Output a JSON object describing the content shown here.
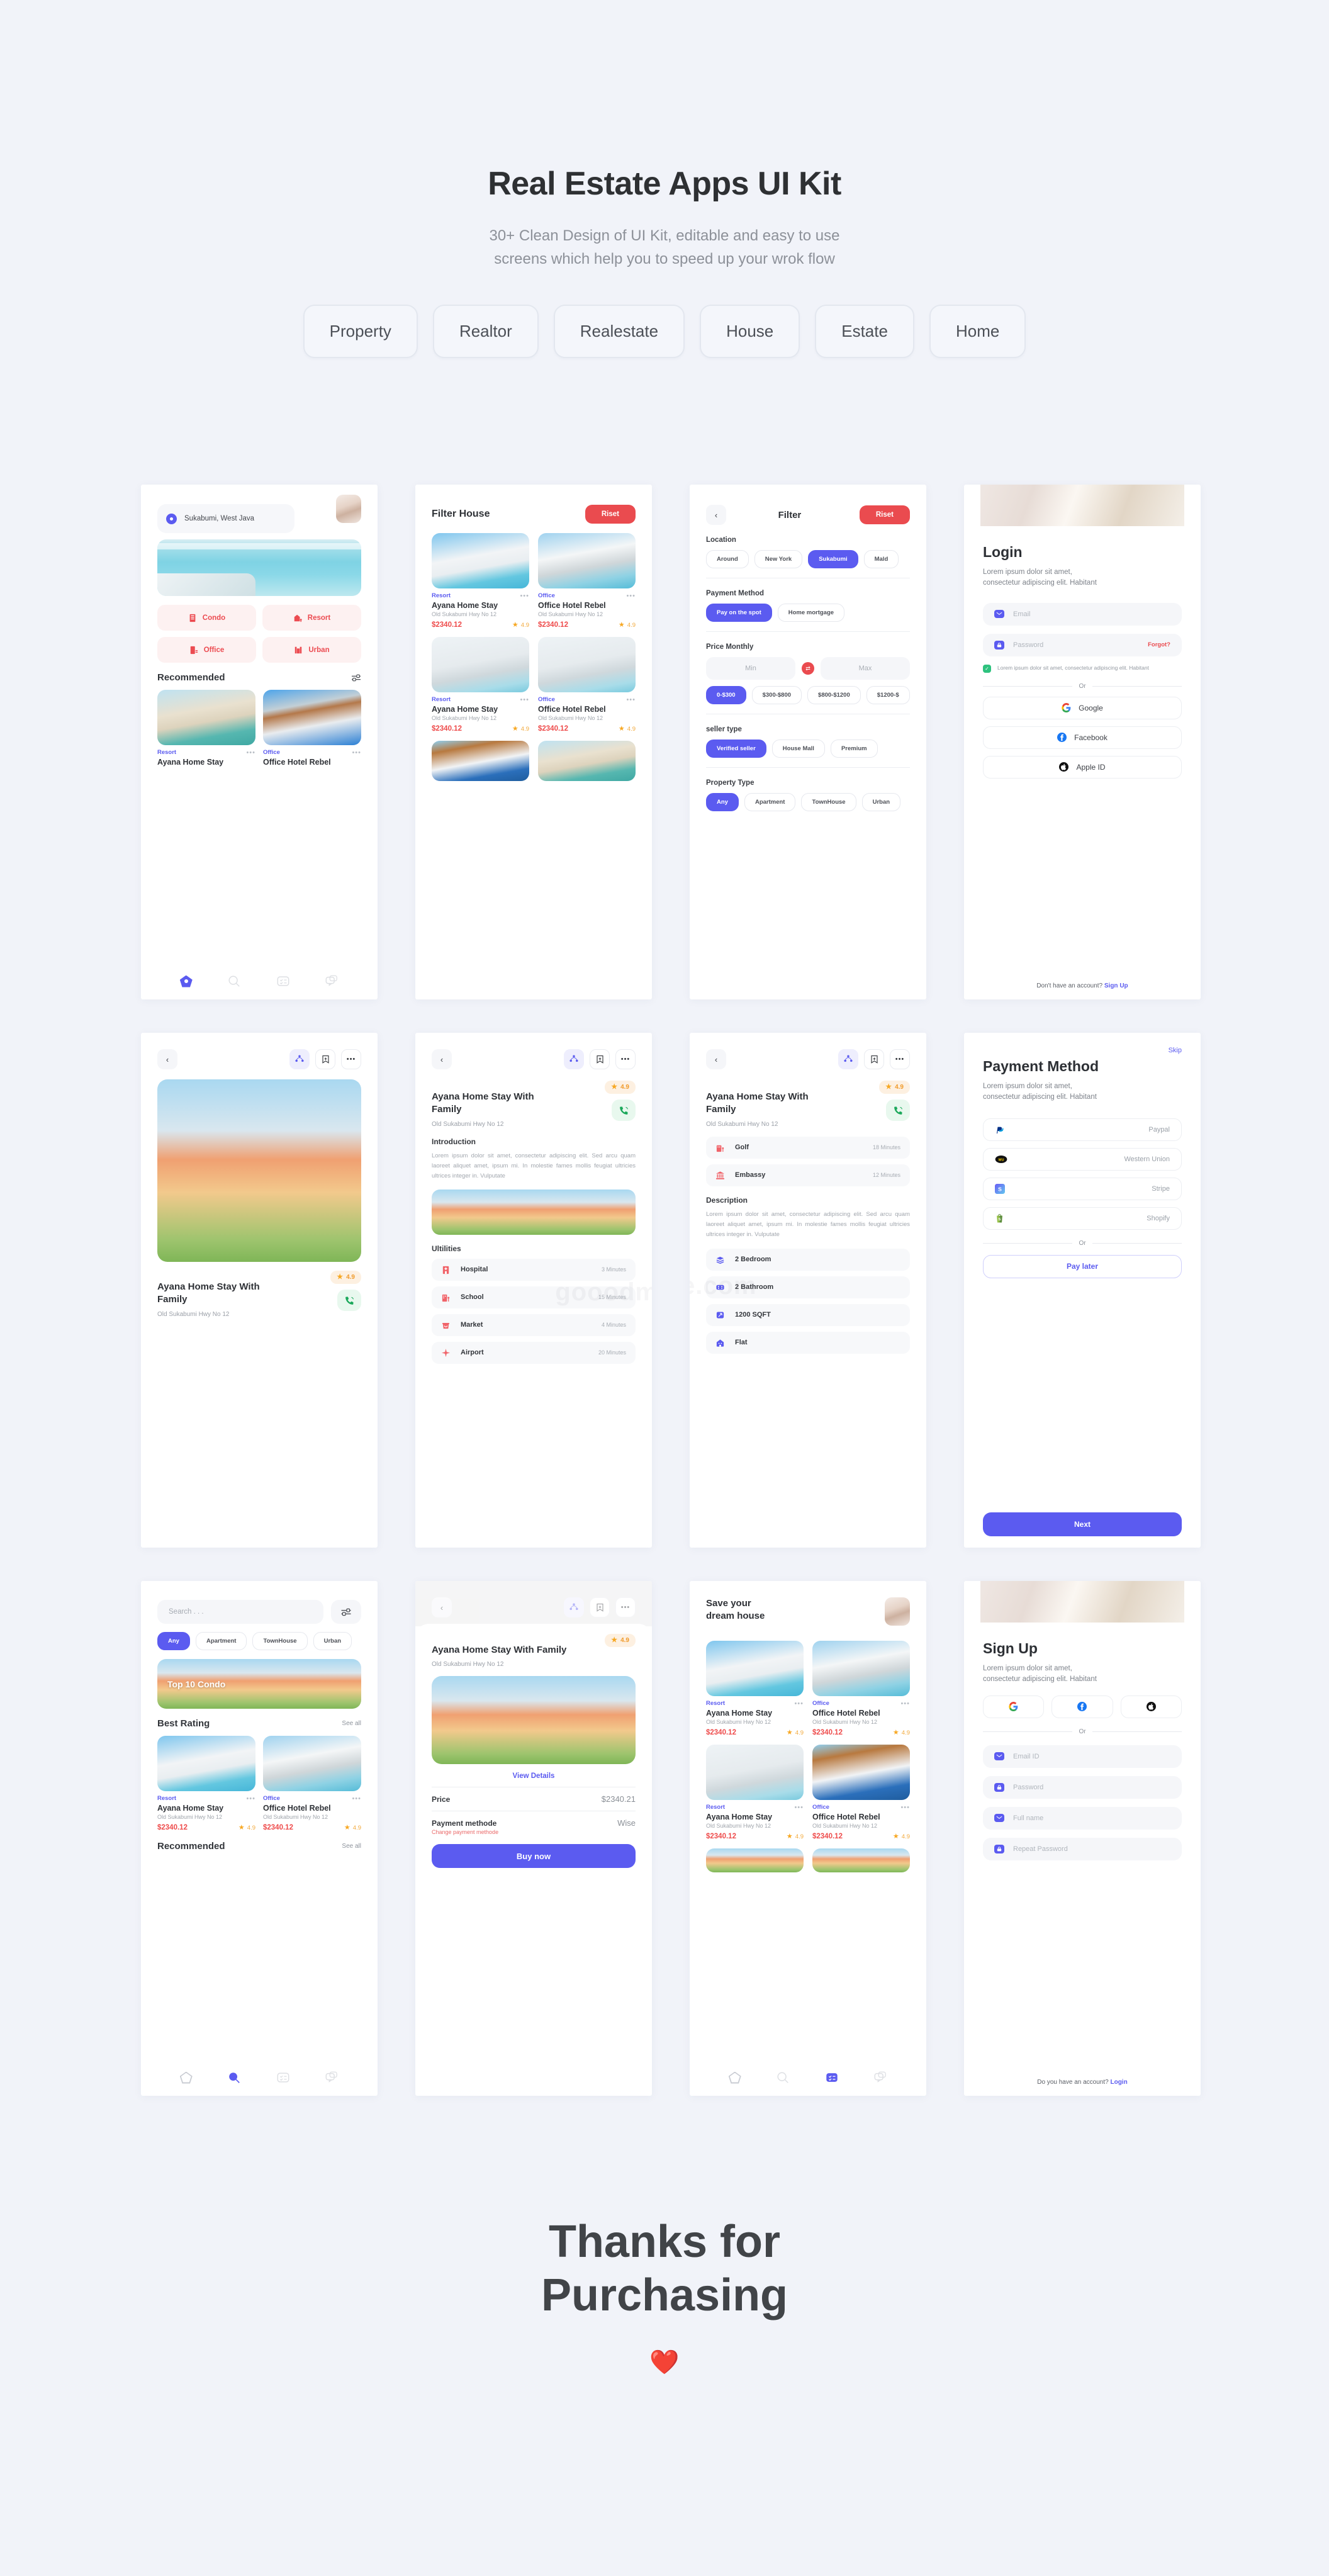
{
  "hero": {
    "title": "Real Estate Apps UI Kit",
    "subtitle_line1": "30+ Clean Design of UI Kit, editable and easy to use",
    "subtitle_line2": "screens which help you to speed up your wrok flow",
    "tags": [
      "Property",
      "Realtor",
      "Realestate",
      "House",
      "Estate",
      "Home"
    ]
  },
  "colors": {
    "background": "#f1f3f9",
    "primary": "#5b5bf0",
    "danger": "#ea4b4f",
    "price": "#ee4b4b",
    "star": "#f7a823",
    "category": "#5b5bf0",
    "success": "#2ec27e"
  },
  "screen_home": {
    "location": "Sukabumi, West Java",
    "categories": [
      {
        "label": "Condo",
        "icon": "condo-icon"
      },
      {
        "label": "Resort",
        "icon": "resort-icon"
      },
      {
        "label": "Office",
        "icon": "office-icon"
      },
      {
        "label": "Urban",
        "icon": "urban-icon"
      }
    ],
    "section_title": "Recommended",
    "cards": [
      {
        "category": "Resort",
        "title": "Ayana Home Stay"
      },
      {
        "category": "Office",
        "title": "Office Hotel Rebel"
      }
    ],
    "nav": [
      "home-icon",
      "search-icon",
      "list-icon",
      "chat-icon"
    ]
  },
  "screen_filter_house": {
    "title": "Filter House",
    "reset_label": "Riset",
    "cards": [
      {
        "category": "Resort",
        "title": "Ayana Home Stay",
        "address": "Old Sukabumi Hwy No 12",
        "price": "$2340.12",
        "rating": "4.9"
      },
      {
        "category": "Office",
        "title": "Office Hotel Rebel",
        "address": "Old Sukabumi Hwy No 12",
        "price": "$2340.12",
        "rating": "4.9"
      },
      {
        "category": "Resort",
        "title": "Ayana Home Stay",
        "address": "Old Sukabumi Hwy No 12",
        "price": "$2340.12",
        "rating": "4.9"
      },
      {
        "category": "Office",
        "title": "Office Hotel Rebel",
        "address": "Old Sukabumi Hwy No 12",
        "price": "$2340.12",
        "rating": "4.9"
      }
    ]
  },
  "screen_filter": {
    "title": "Filter",
    "reset_label": "Riset",
    "sections": [
      {
        "label": "Location",
        "chips": [
          "Around",
          "New York",
          "Sukabumi",
          "Mald"
        ],
        "selected": 2
      },
      {
        "label": "Payment Method",
        "chips": [
          "Pay on the spot",
          "Home mortgage"
        ],
        "selected": 0
      },
      {
        "label": "Price Monthly",
        "chips": [
          "0-$300",
          "$300-$800",
          "$800-$1200",
          "$1200-$"
        ],
        "selected": 0
      },
      {
        "label": "seller type",
        "chips": [
          "Verified seller",
          "House Mall",
          "Premium"
        ],
        "selected": 0
      },
      {
        "label": "Property Type",
        "chips": [
          "Any",
          "Apartment",
          "TownHouse",
          "Urban"
        ],
        "selected": 0
      }
    ],
    "min_placeholder": "Min",
    "max_placeholder": "Max"
  },
  "screen_login": {
    "title": "Login",
    "subtitle_line1": "Lorem ipsum dolor sit amet,",
    "subtitle_line2": "consectetur adipiscing elit. Habitant",
    "email_placeholder": "Email",
    "password_placeholder": "Password",
    "forgot_label": "Forgot?",
    "consent": "Lorem ipsum dolor sit amet, consectetur adipiscing elit. Habitant",
    "or_label": "Or",
    "socials": [
      "Google",
      "Facebook",
      "Apple ID"
    ],
    "footer_text": "Don't have an account?",
    "footer_link": "Sign Up"
  },
  "screen_detail_photo": {
    "title": "Ayana Home Stay With Family",
    "address": "Old Sukabumi Hwy No 12",
    "rating": "4.9"
  },
  "screen_detail_intro": {
    "title": "Ayana Home Stay With Family",
    "address": "Old Sukabumi Hwy No 12",
    "rating": "4.9",
    "intro_heading": "Introduction",
    "intro_text": "Lorem ipsum dolor sit amet, consectetur adipiscing elit. Sed arcu quam laoreet aliquet amet, ipsum mi. In molestie fames mollis feugiat ultricies ultrices integer in. Vulputate",
    "utilities_heading": "Ultilities",
    "utilities": [
      {
        "name": "Hospital",
        "time": "3 Minutes",
        "icon": "hospital-icon"
      },
      {
        "name": "School",
        "time": "15 Minutes",
        "icon": "school-icon"
      },
      {
        "name": "Market",
        "time": "4 Minutes",
        "icon": "market-icon"
      },
      {
        "name": "Airport",
        "time": "20 Minutes",
        "icon": "airport-icon"
      }
    ],
    "watermark": "gooodm"
  },
  "screen_detail_desc": {
    "title": "Ayana Home Stay With Family",
    "address": "Old Sukabumi Hwy No 12",
    "rating": "4.9",
    "utilities": [
      {
        "name": "Golf",
        "time": "18  Minutes",
        "icon": "golf-icon"
      },
      {
        "name": "Embassy",
        "time": "12  Minutes",
        "icon": "embassy-icon"
      }
    ],
    "desc_heading": "Description",
    "desc_text": "Lorem ipsum dolor sit amet, consectetur adipiscing elit. Sed arcu quam laoreet aliquet amet, ipsum mi. In molestie fames mollis feugiat ultricies ultrices integer in. Vulputate",
    "specs": [
      {
        "name": "2 Bedroom",
        "icon": "bed-icon"
      },
      {
        "name": "2 Bathroom",
        "icon": "bath-icon"
      },
      {
        "name": "1200 SQFT",
        "icon": "area-icon"
      },
      {
        "name": "Flat",
        "icon": "flat-icon"
      }
    ],
    "watermark": "e.com"
  },
  "screen_payment": {
    "skip_label": "Skip",
    "title": "Payment Method",
    "subtitle_line1": "Lorem ipsum dolor sit amet,",
    "subtitle_line2": "consectetur adipiscing elit. Habitant",
    "methods": [
      {
        "name": "Paypal",
        "icon": "paypal-icon"
      },
      {
        "name": "Western Union",
        "icon": "western-union-icon"
      },
      {
        "name": "Stripe",
        "icon": "stripe-icon"
      },
      {
        "name": "Shopify",
        "icon": "shopify-icon"
      }
    ],
    "or_label": "Or",
    "pay_later_label": "Pay later",
    "next_label": "Next"
  },
  "screen_search": {
    "search_placeholder": "Search . . .",
    "chips": [
      "Any",
      "Apartment",
      "TownHouse",
      "Urban"
    ],
    "selected_chip": 0,
    "banner_title": "Top 10 Condo",
    "best_rating_title": "Best Rating",
    "see_all": "See all",
    "recommended_title": "Recommended",
    "cards": [
      {
        "category": "Resort",
        "title": "Ayana Home Stay",
        "address": "Old Sukabumi Hwy No 12",
        "price": "$2340.12",
        "rating": "4.9"
      },
      {
        "category": "Office",
        "title": "Office Hotel Rebel",
        "address": "Old Sukabumi Hwy No 12",
        "price": "$2340.12",
        "rating": "4.9"
      }
    ]
  },
  "screen_buy": {
    "title": "Ayana Home Stay With Family",
    "address": "Old Sukabumi Hwy No 12",
    "rating": "4.9",
    "view_details": "View Details",
    "price_label": "Price",
    "price_value": "$2340.21",
    "payment_label": "Payment methode",
    "payment_value": "Wise",
    "change_payment": "Change payment methode",
    "buy_label": "Buy now"
  },
  "screen_save": {
    "title_line1": "Save your",
    "title_line2": "dream house",
    "cards": [
      {
        "category": "Resort",
        "title": "Ayana Home Stay",
        "address": "Old Sukabumi Hwy No 12",
        "price": "$2340.12",
        "rating": "4.9"
      },
      {
        "category": "Office",
        "title": "Office Hotel Rebel",
        "address": "Old Sukabumi Hwy No 12",
        "price": "$2340.12",
        "rating": "4.9"
      },
      {
        "category": "Resort",
        "title": "Ayana Home Stay",
        "address": "Old Sukabumi Hwy No 12",
        "price": "$2340.12",
        "rating": "4.9"
      },
      {
        "category": "Office",
        "title": "Office Hotel Rebel",
        "address": "Old Sukabumi Hwy No 12",
        "price": "$2340.12",
        "rating": "4.9"
      }
    ]
  },
  "screen_signup": {
    "title": "Sign Up",
    "subtitle_line1": "Lorem ipsum dolor sit amet,",
    "subtitle_line2": "consectetur adipiscing elit. Habitant",
    "or_label": "Or",
    "fields": [
      "Email ID",
      "Password",
      "Full name",
      "Repeat Password"
    ],
    "footer_text": "Do you have an account?",
    "footer_link": "Login"
  },
  "footer": {
    "title_line1": "Thanks for",
    "title_line2": "Purchasing",
    "heart": "❤️"
  }
}
